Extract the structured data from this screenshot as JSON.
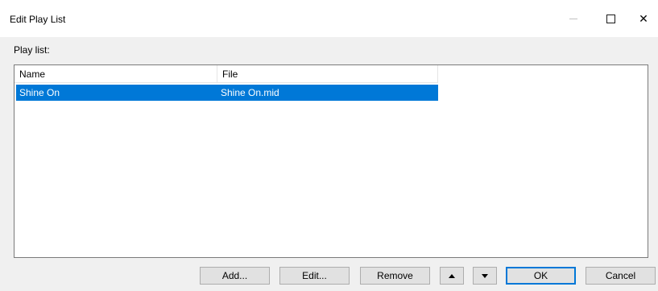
{
  "window": {
    "title": "Edit Play List",
    "minimize_icon": "minimize-icon",
    "maximize_icon": "maximize-icon",
    "close_icon": "close-icon",
    "close_glyph": "✕"
  },
  "playlist": {
    "label": "Play list:",
    "columns": {
      "name": "Name",
      "file": "File"
    },
    "rows": [
      {
        "name": "Shine On",
        "file": "Shine On.mid",
        "selected": true
      }
    ],
    "selection_color": "#0078d7"
  },
  "buttons": {
    "add": "Add...",
    "edit": "Edit...",
    "remove": "Remove",
    "move_up_icon": "arrow-up-icon",
    "move_down_icon": "arrow-down-icon",
    "ok": "OK",
    "cancel": "Cancel"
  }
}
